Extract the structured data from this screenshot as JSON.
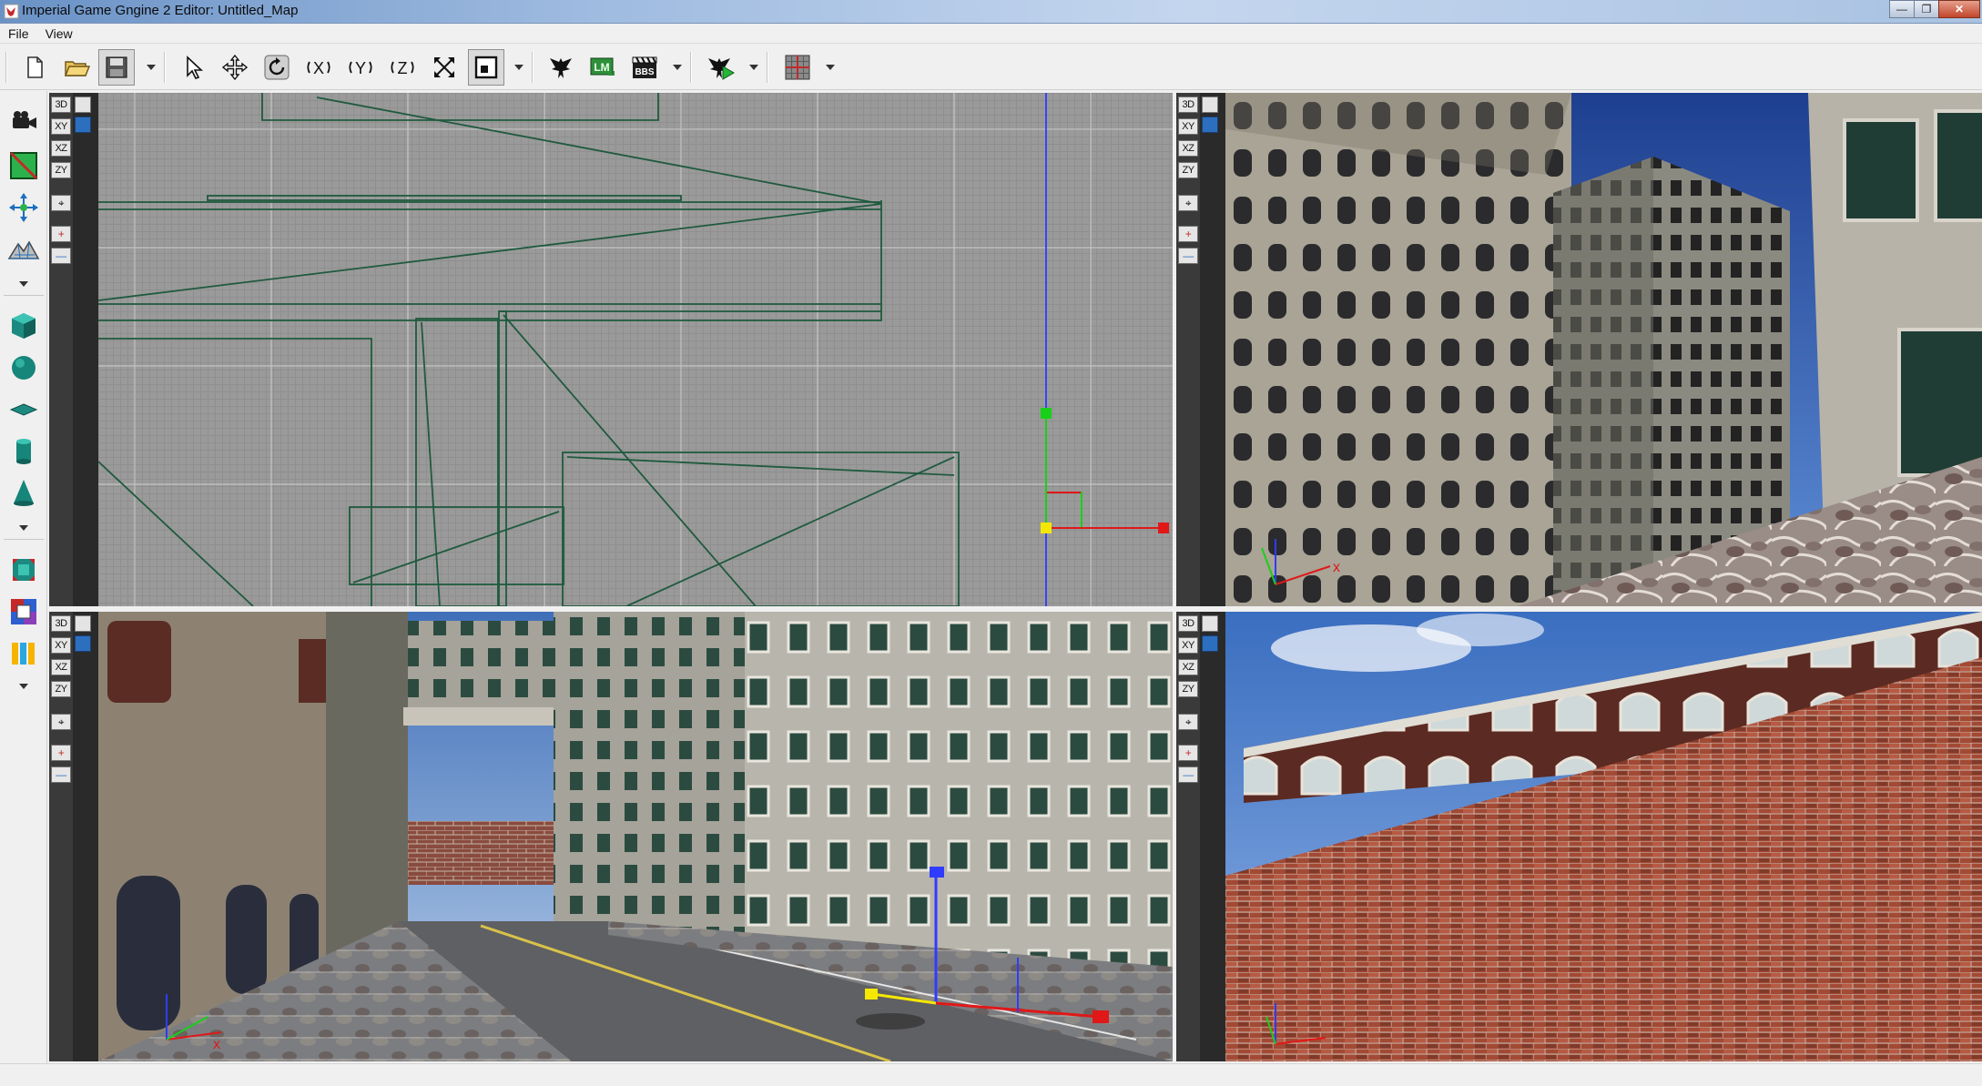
{
  "window": {
    "title": "Imperial Game Gngine 2 Editor: Untitled_Map",
    "minimize_glyph": "—",
    "restore_glyph": "❐",
    "close_glyph": "✕"
  },
  "menu": {
    "items": [
      {
        "label": "File"
      },
      {
        "label": "View"
      }
    ]
  },
  "toolbar": {
    "rotate_x_label": "X",
    "rotate_y_label": "Y",
    "rotate_z_label": "Z",
    "bbs_label": "BBS",
    "lm_label": "LM"
  },
  "viewport_controls": {
    "view_3d": "3D",
    "view_xy": "XY",
    "view_xz": "XZ",
    "view_zy": "ZY",
    "center": "⌖",
    "zoom_in": "+",
    "zoom_out": "—"
  },
  "viewports": [
    {
      "id": "top-left",
      "mode": "XY"
    },
    {
      "id": "top-right",
      "mode": "3D"
    },
    {
      "id": "bottom-left",
      "mode": "3D"
    },
    {
      "id": "bottom-right",
      "mode": "3D"
    }
  ],
  "colors": {
    "wire": "#1f5a3e",
    "axis_blue": "#2f3cff",
    "axis_red": "#e01818",
    "axis_green": "#18d018",
    "gizmo_yellow": "#f5e800"
  },
  "axis_labels": {
    "x": "x"
  }
}
